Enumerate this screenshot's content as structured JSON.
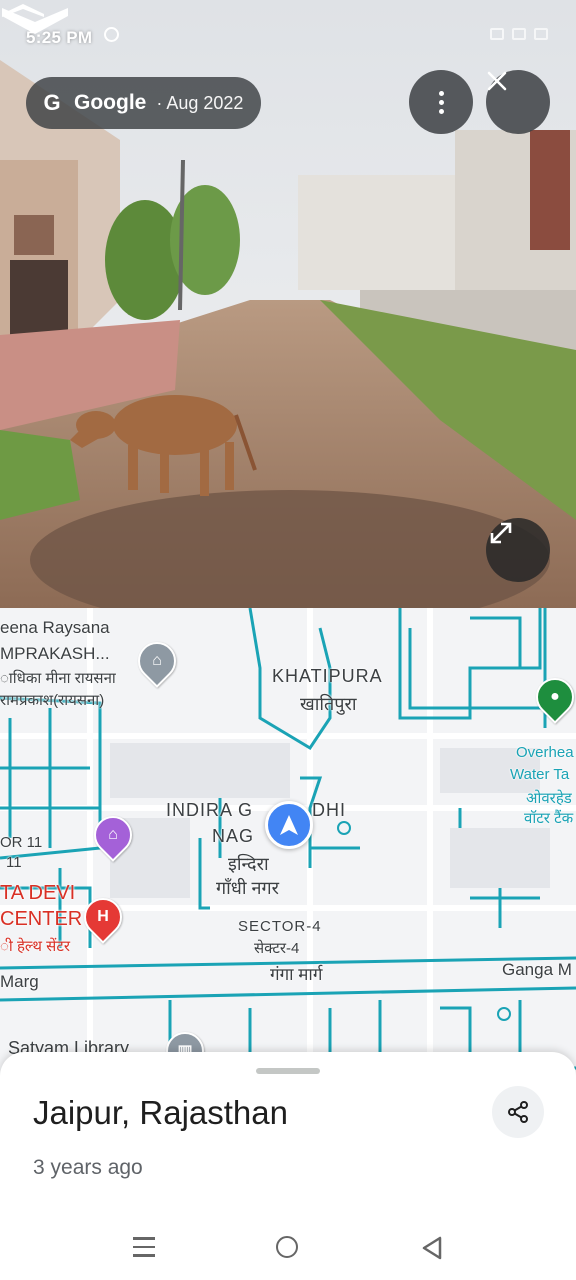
{
  "status_bar": {
    "time": "5:25 PM"
  },
  "street_view": {
    "chip_brand": "Google",
    "chip_date": "· Aug 2022",
    "more_icon": "more-vert-icon",
    "close_icon": "close-icon",
    "expand_icon": "fullscreen-icon"
  },
  "map": {
    "labels": {
      "meena": "eena Raysana",
      "omprakash": "MPRAKASH...",
      "radhika": "ाधिका मीना रायसना",
      "ramprakash": "रामप्रकाश(रायसना)",
      "khatipura_en": "KHATIPURA",
      "khatipura_hi": "खातिपुरा",
      "overhead1": "Overhea",
      "overhead2": "Water Ta",
      "overhead3": "ओवरहेड",
      "overhead4": "वॉटर टैंक",
      "indira1": "INDIRA G",
      "indira2": "DHI",
      "indira3": "NAG",
      "indira_hi1": "इन्दिरा",
      "indira_hi2": "गाँधी नगर",
      "sector11a": "OR 11",
      "sector11b": "11",
      "tadevi": "TA DEVI",
      "center": "CENTER",
      "health_hi": "ी हेल्थ सेंटर",
      "sector4": "SECTOR-4",
      "sector4_hi": "सेक्टर-4",
      "marg": "Marg",
      "ganga_hi": "गंगा मार्ग",
      "ganga_en": "Ganga M",
      "library": "Satyam Library"
    },
    "accent": "#1aa3b5",
    "arrow_color": "#4285f4"
  },
  "sheet": {
    "title": "Jaipur, Rajasthan",
    "subtitle": "3 years ago",
    "share_icon": "share-icon"
  }
}
